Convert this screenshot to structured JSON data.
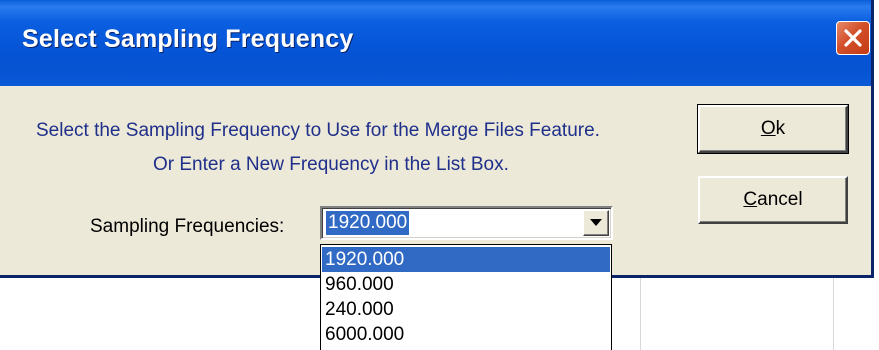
{
  "window": {
    "title": "Select Sampling Frequency"
  },
  "message": {
    "line1": "Select the Sampling Frequency to Use for the Merge Files Feature.",
    "line2": "Or Enter a New Frequency in the List Box."
  },
  "frequency": {
    "label": "Sampling Frequencies:",
    "value": "1920.000",
    "options": [
      "1920.000",
      "960.000",
      "240.000",
      "6000.000"
    ],
    "selected_index": 0
  },
  "buttons": {
    "ok_mnemonic": "O",
    "ok_rest": "k",
    "cancel_mnemonic": "C",
    "cancel_rest": "ancel"
  },
  "colors": {
    "titlebar": "#0655d8",
    "selection": "#316ac5",
    "dialog_face": "#ece9d8",
    "close_button": "#d2502a"
  },
  "icons": {
    "close": "close-icon",
    "dropdown": "chevron-down-icon"
  }
}
